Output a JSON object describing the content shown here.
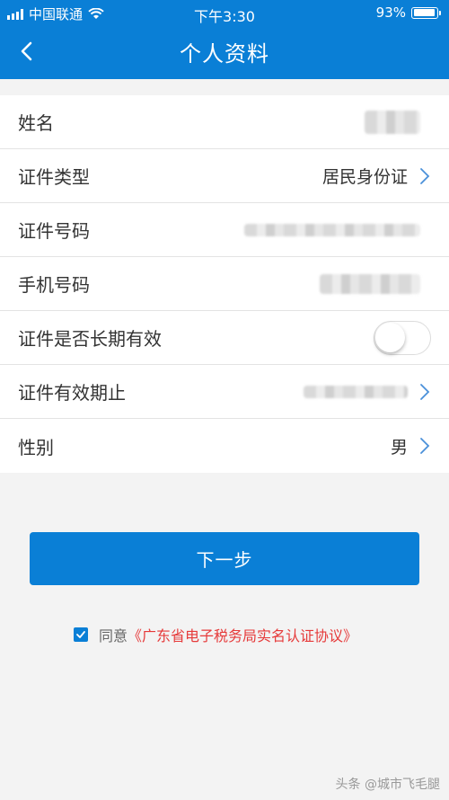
{
  "status_bar": {
    "carrier": "中国联通",
    "time": "下午3:30",
    "battery": "93%",
    "battery_level": 0.93
  },
  "navbar": {
    "title": "个人资料",
    "back_icon": "chevron-left-icon"
  },
  "form": {
    "rows": [
      {
        "label": "姓名",
        "value": "",
        "masked": true
      },
      {
        "label": "证件类型",
        "value": "居民身份证",
        "masked": false
      },
      {
        "label": "证件号码",
        "value": "",
        "masked": true
      },
      {
        "label": "手机号码",
        "value": "",
        "masked": true
      },
      {
        "label": "证件是否长期有效",
        "toggle": false
      },
      {
        "label": "证件有效期止",
        "value": "",
        "masked": true
      },
      {
        "label": "性别",
        "value": "男",
        "masked": false
      }
    ]
  },
  "next_button": {
    "label": "下一步"
  },
  "agreement": {
    "checked": true,
    "prefix": "同意",
    "link": "《广东省电子税务局实名认证协议》"
  },
  "watermark": {
    "text": "头条 @城市飞毛腿"
  },
  "colors": {
    "primary": "#0a7fd6",
    "link": "#e63a3a",
    "background": "#f3f3f3"
  }
}
